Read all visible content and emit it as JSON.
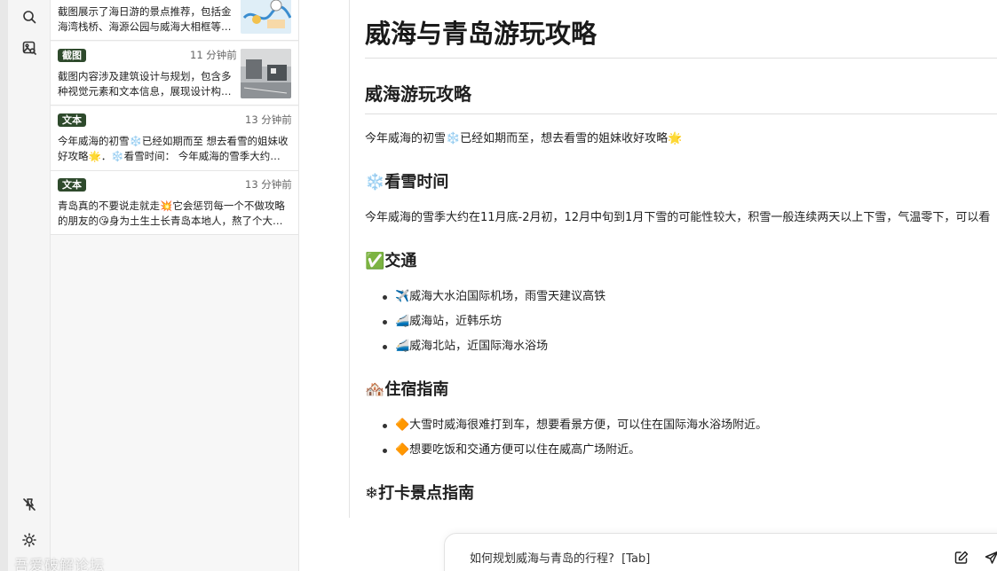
{
  "feed": {
    "items": [
      {
        "tag": "",
        "time": "",
        "desc": "截图展示了海日游的景点推荐，包括金海湾栈桥、海源公园与威海大相框等…"
      },
      {
        "tag": "截图",
        "time": "11 分钟前",
        "desc": "截图内容涉及建筑设计与规划，包含多种视觉元素和文本信息，展现设计构…"
      },
      {
        "tag": "文本",
        "time": "13 分钟前",
        "desc": "今年威海的初雪❄️已经如期而至 想去看雪的姐妹收好攻略🌟．❄️看雪时间： 今年威海的雪季大约…"
      },
      {
        "tag": "文本",
        "time": "13 分钟前",
        "desc": "青岛真的不要说走就走💥它会惩罚每一个不做攻略的朋友的😘身为土生土长青岛本地人，熬了个大…"
      }
    ]
  },
  "doc": {
    "title": "威海与青岛游玩攻略",
    "section_weihai": "威海游玩攻略",
    "intro": "今年威海的初雪❄️已经如期而至，想去看雪的姐妹收好攻略🌟",
    "snow_heading": "❄️看雪时间",
    "snow_text": "今年威海的雪季大约在11月底-2月初，12月中旬到1月下雪的可能性较大，积雪一般连续两天以上下雪，气温零下，可以看",
    "transport_heading": "✅交通",
    "transport_items": [
      "✈️威海大水泊国际机场，雨雪天建议高铁",
      "🚄威海站，近韩乐坊",
      "🚄威海北站，近国际海水浴场"
    ],
    "lodging_heading": "🏘️住宿指南",
    "lodging_items": [
      "🔶大雪时威海很难打到车，想要看景方便，可以住在国际海水浴场附近。",
      "🔶想要吃饭和交通方便可以住在威高广场附近。"
    ],
    "spots_heading": "❄打卡景点指南"
  },
  "prompt": {
    "placeholder": "如何规划威海与青岛的行程?  [Tab]"
  },
  "icons": {
    "search": "search-icon",
    "image_search": "image-search-icon",
    "unpin": "unpin-icon",
    "theme": "sun-icon",
    "edit": "edit-icon",
    "send": "send-icon"
  },
  "colors": {
    "tag_bg": "#2e4a2c",
    "rail_bg": "#f5f5f5",
    "feed_bg": "#f7f7f7"
  },
  "watermark": "吾爱破解论坛"
}
